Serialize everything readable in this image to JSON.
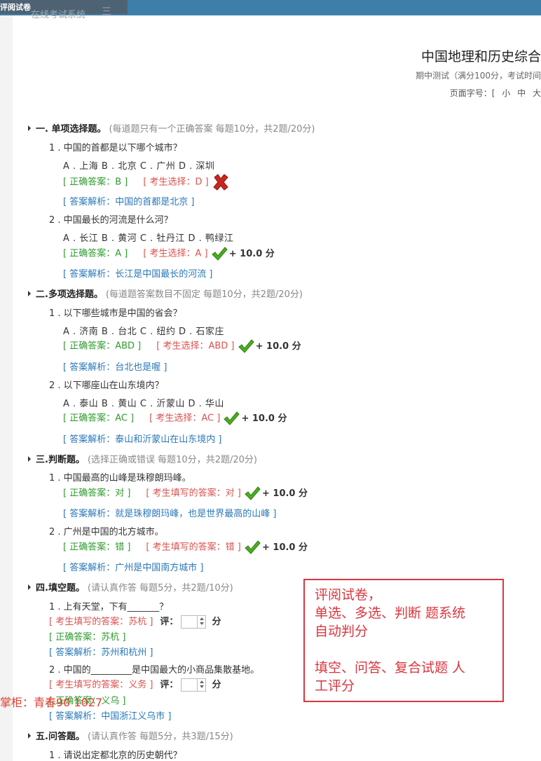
{
  "window": {
    "tab_title": "评阅试卷",
    "back_label": "在线考试系统",
    "menu_label": "三"
  },
  "paper": {
    "title": "中国地理和历史综合",
    "subtitle": "期中测试（满分100分，考试时间",
    "font_size_label": "页面字号：[",
    "font_sizes": [
      "小",
      "中",
      "大"
    ]
  },
  "sections": [
    {
      "title": "一. 单项选择题。",
      "desc": "(每道题只有一个正确答案 每题10分，共2题/20分)",
      "questions": [
        {
          "text": "1 . 中国的首都是以下哪个城市？",
          "options": "A . 上海   B . 北京   C . 广州   D . 深圳",
          "correct": "[ 正确答案：B ]",
          "student": "[ 考生选择：D ]",
          "result": "wrong",
          "score": "",
          "analysis": "[ 答案解析：中国的首都是北京 ]"
        },
        {
          "text": "2 . 中国最长的河流是什么河？",
          "options": "A . 长江   B . 黄河   C . 牡丹江   D . 鸭绿江",
          "correct": "[ 正确答案：A ]",
          "student": "[ 考生选择：A ]",
          "result": "right",
          "score": "+ 10.0 分",
          "analysis": "[ 答案解析：长江是中国最长的河流 ]"
        }
      ]
    },
    {
      "title": "二.多项选择题。",
      "desc": "(每道题答案数目不固定 每题10分，共2题/20分)",
      "questions": [
        {
          "text": "1 . 以下哪些城市是中国的省会？",
          "options": "A . 济南   B . 台北   C . 纽约   D . 石家庄",
          "correct": "[ 正确答案：ABD ]",
          "student": "[ 考生选择：ABD ]",
          "result": "right",
          "score": "+ 10.0 分",
          "analysis": "[ 答案解析：台北也是喔 ]"
        },
        {
          "text": "2 . 以下哪座山在山东境内？",
          "options": "A . 泰山   B . 黄山   C . 沂蒙山   D . 华山",
          "correct": "[ 正确答案：AC ]",
          "student": "[ 考生选择：AC ]",
          "result": "right",
          "score": "+ 10.0 分",
          "analysis": "[ 答案解析：泰山和沂蒙山在山东境内 ]"
        }
      ]
    },
    {
      "title": "三.判断题。",
      "desc": "(选择正确或错误 每题10分，共2题/20分)",
      "questions": [
        {
          "text": "1 . 中国最高的山峰是珠穆朗玛峰。",
          "correct": "[ 正确答案：对 ]",
          "student": "[ 考生填写的答案：对 ]",
          "result": "right",
          "score": "+ 10.0 分",
          "analysis": "[ 答案解析：就是珠穆朗玛峰，也是世界最高的山峰 ]"
        },
        {
          "text": "2 . 广州是中国的北方城市。",
          "correct": "[ 正确答案：错 ]",
          "student": "[ 考生填写的答案：错 ]",
          "result": "right",
          "score": "+ 10.0 分",
          "analysis": "[ 答案解析：广州是中国南方城市 ]"
        }
      ]
    },
    {
      "title": "四.填空题。",
      "desc": "(请认真作答 每题5分，共2题/10分)",
      "questions": [
        {
          "text": "1 . 上有天堂，下有_______？",
          "student": "[ 考生填写的答案：苏杭 ]",
          "grade_label": "评：",
          "unit": "分",
          "correct": "[ 正确答案：苏杭 ]",
          "analysis": "[ 答案解析：苏州和杭州 ]"
        },
        {
          "text": "2 . 中国的_________是中国最大的小商品集散基地。",
          "student": "[ 考生填写的答案：义务 ]",
          "grade_label": "评：",
          "unit": "分",
          "correct": "[ 正确答案：义乌 ]",
          "analysis": "[ 答案解析：中国浙江义乌市 ]"
        }
      ]
    },
    {
      "title": "五.问答题。",
      "desc": "(请认真作答 每题5分，共3题/15分)",
      "questions": [
        {
          "text": "1 . 请说出定都北京的历史朝代？"
        }
      ]
    }
  ],
  "note": {
    "lines": [
      "评阅试卷，",
      "单选、多选、判断 题系统",
      "自动判分",
      "",
      "填空、问答、复合试题 人",
      "工评分"
    ]
  },
  "watermark": "掌柜：青春90 1027",
  "colors": {
    "correct": "#2e9b2e",
    "student": "#d9534f",
    "analysis": "#2a78b8",
    "note": "#d9363e",
    "topbar": "#3d7fa8"
  }
}
